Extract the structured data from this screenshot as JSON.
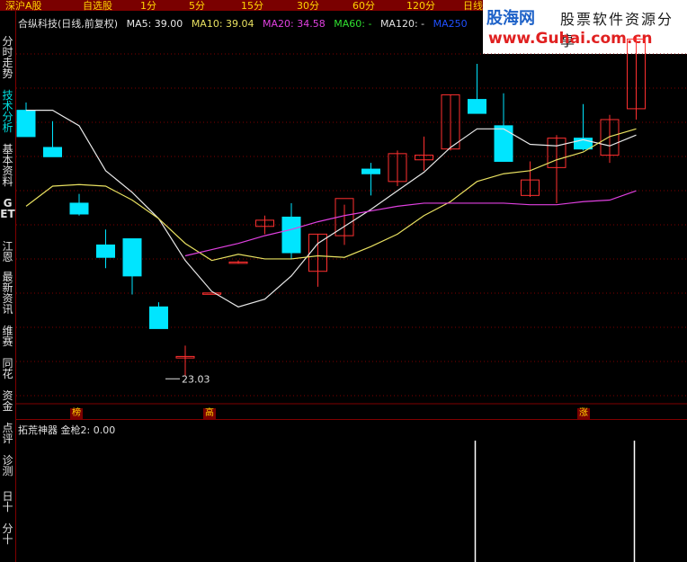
{
  "top_tabs": [
    "深沪A股",
    "自选股",
    "1分",
    "5分",
    "15分",
    "30分",
    "60分",
    "120分",
    "日线"
  ],
  "sidebar": [
    {
      "label": "分时走势",
      "active": false
    },
    {
      "label": "技术分析",
      "active": true
    },
    {
      "label": "基本资料",
      "active": false
    },
    {
      "label": "GET",
      "active": false
    },
    {
      "label": "江恩",
      "active": false
    },
    {
      "label": "最新资讯",
      "active": false
    },
    {
      "label": "维赛",
      "active": false
    },
    {
      "label": "同花",
      "active": false
    },
    {
      "label": "资金",
      "active": false
    },
    {
      "label": "点评",
      "active": false
    },
    {
      "label": "诊测",
      "active": false
    },
    {
      "label": "日十",
      "active": false
    },
    {
      "label": "分十",
      "active": false
    }
  ],
  "info": {
    "title": "合纵科技(日线,前复权)",
    "ma5": "MA5: 39.00",
    "ma10": "MA10: 39.04",
    "ma20": "MA20: 34.58",
    "ma60": "MA60: -",
    "ma120": "MA120: -",
    "ma250": "MA250"
  },
  "colors": {
    "up": "#ff3030",
    "down": "#00e5ff",
    "ma5": "#e8e8e8",
    "ma10": "#e8e060",
    "ma20": "#e040e0",
    "ma60": "#30e030",
    "ma250": "#2050ff",
    "bg": "#000000",
    "grid": "#800000"
  },
  "logo": {
    "line1": "股海网",
    "line1b": "股票软件资源分享",
    "line2": "www.Guhai.com.cn"
  },
  "badges": {
    "left": "榜",
    "mid": "高",
    "right": "涨"
  },
  "low_label": "23.03",
  "sub_indicator": {
    "name": "拓荒神器",
    "value": "金枪2: 0.00"
  },
  "chart_data": {
    "type": "candlestick",
    "title": "合纵科技(日线,前复权)",
    "ylim": [
      22,
      45
    ],
    "candles": [
      {
        "o": 40.2,
        "h": 40.7,
        "l": 39.3,
        "c": 38.5
      },
      {
        "o": 37.8,
        "h": 39.5,
        "l": 37.3,
        "c": 37.2
      },
      {
        "o": 34.2,
        "h": 34.8,
        "l": 33.4,
        "c": 33.5
      },
      {
        "o": 31.5,
        "h": 32.5,
        "l": 30.0,
        "c": 30.7
      },
      {
        "o": 31.9,
        "h": 31.9,
        "l": 28.3,
        "c": 29.5
      },
      {
        "o": 27.5,
        "h": 27.8,
        "l": 26.3,
        "c": 26.1
      },
      {
        "o": 24.2,
        "h": 25.0,
        "l": 23.03,
        "c": 24.3
      },
      {
        "o": 28.4,
        "h": 28.4,
        "l": 28.4,
        "c": 28.4
      },
      {
        "o": 30.4,
        "h": 30.5,
        "l": 30.3,
        "c": 30.4
      },
      {
        "o": 32.7,
        "h": 33.4,
        "l": 32.2,
        "c": 33.1
      },
      {
        "o": 33.3,
        "h": 34.2,
        "l": 30.6,
        "c": 31.0
      },
      {
        "o": 29.8,
        "h": 32.2,
        "l": 28.8,
        "c": 32.2
      },
      {
        "o": 32.1,
        "h": 34.1,
        "l": 31.5,
        "c": 34.5
      },
      {
        "o": 36.4,
        "h": 36.8,
        "l": 34.7,
        "c": 36.1
      },
      {
        "o": 35.6,
        "h": 37.6,
        "l": 35.3,
        "c": 37.4
      },
      {
        "o": 37.0,
        "h": 38.5,
        "l": 36.3,
        "c": 37.3
      },
      {
        "o": 37.7,
        "h": 41.2,
        "l": 37.6,
        "c": 41.2
      },
      {
        "o": 40.9,
        "h": 43.2,
        "l": 40.0,
        "c": 40.0
      },
      {
        "o": 39.2,
        "h": 41.3,
        "l": 38.6,
        "c": 36.9
      },
      {
        "o": 34.7,
        "h": 36.9,
        "l": 34.6,
        "c": 35.7
      },
      {
        "o": 36.5,
        "h": 38.6,
        "l": 34.2,
        "c": 38.4
      },
      {
        "o": 38.4,
        "h": 40.6,
        "l": 37.6,
        "c": 37.7
      },
      {
        "o": 37.3,
        "h": 39.9,
        "l": 36.8,
        "c": 39.6
      },
      {
        "o": 40.3,
        "h": 45.0,
        "l": 39.6,
        "c": 44.8
      }
    ],
    "ma5": [
      40.2,
      40.2,
      39.2,
      36.3,
      34.9,
      33.2,
      30.5,
      28.5,
      27.5,
      28.0,
      29.5,
      31.6,
      32.7,
      33.8,
      35.0,
      36.2,
      37.8,
      39.0,
      39.0,
      38.0,
      37.9,
      38.3,
      37.9,
      38.6
    ],
    "ma10": [
      34.0,
      35.3,
      35.4,
      35.3,
      34.4,
      33.2,
      31.6,
      30.5,
      30.9,
      30.6,
      30.6,
      30.8,
      30.7,
      31.4,
      32.2,
      33.4,
      34.3,
      35.6,
      36.1,
      36.3,
      37.0,
      37.5,
      38.5,
      39.0
    ],
    "ma20": [
      null,
      null,
      null,
      null,
      null,
      null,
      30.8,
      31.2,
      31.6,
      32.1,
      32.5,
      33.0,
      33.4,
      33.7,
      34.0,
      34.2,
      34.2,
      34.2,
      34.2,
      34.1,
      34.1,
      34.3,
      34.4,
      35.0
    ],
    "sub_signals": [
      17,
      23
    ]
  }
}
